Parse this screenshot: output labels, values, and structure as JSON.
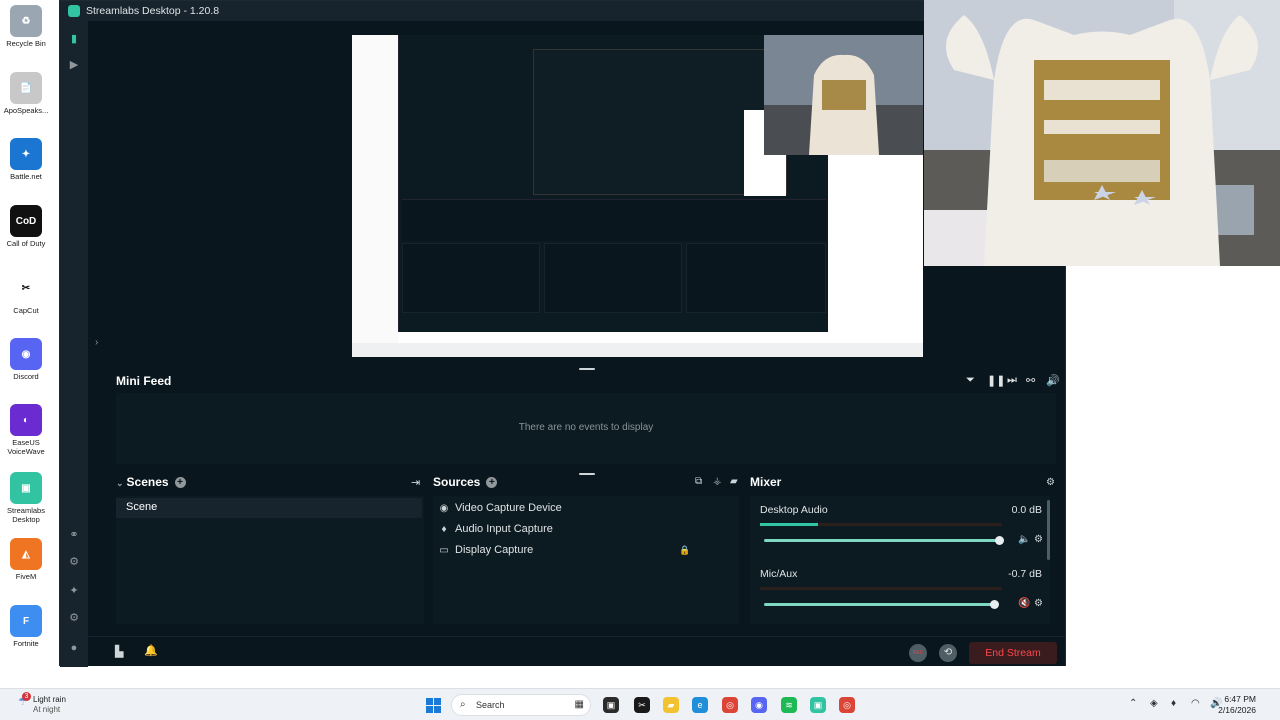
{
  "desktop": {
    "icons": [
      {
        "label": "Recycle Bin",
        "symbol": "♻",
        "color": "#9aa6b2"
      },
      {
        "label": "ApoSpeaks...",
        "symbol": "📄",
        "color": "#c8c8c8"
      },
      {
        "label": "Battle.net",
        "symbol": "✦",
        "color": "#1b76d2"
      },
      {
        "label": "Call of Duty",
        "symbol": "CoD",
        "color": "#111111"
      },
      {
        "label": "CapCut",
        "symbol": "✂",
        "color": "#ffffff"
      },
      {
        "label": "Discord",
        "symbol": "◉",
        "color": "#5865f2"
      },
      {
        "label": "EaseUS VoiceWave",
        "symbol": "◐",
        "color": "#6a2bd1"
      },
      {
        "label": "Streamlabs Desktop",
        "symbol": "▣",
        "color": "#31c3a2"
      },
      {
        "label": "FiveM",
        "symbol": "◭",
        "color": "#f07522"
      },
      {
        "label": "Fortnite",
        "symbol": "F",
        "color": "#3d8ef0"
      }
    ]
  },
  "app": {
    "title": "Streamlabs Desktop - 1.20.8",
    "mini_feed": {
      "title": "Mini Feed",
      "empty_text": "There are no events to display"
    },
    "scenes": {
      "title": "Scenes",
      "items": [
        "Scene"
      ]
    },
    "sources": {
      "title": "Sources",
      "items": [
        {
          "label": "Video Capture Device",
          "icon": "webcam-icon"
        },
        {
          "label": "Audio Input Capture",
          "icon": "microphone-icon"
        },
        {
          "label": "Display Capture",
          "icon": "monitor-icon"
        }
      ]
    },
    "mixer": {
      "title": "Mixer",
      "channels": [
        {
          "name": "Desktop Audio",
          "db": "0.0 dB",
          "level": 0.24,
          "volume": 1.0,
          "muted": false
        },
        {
          "name": "Mic/Aux",
          "db": "-0.7 dB",
          "level": 0.0,
          "volume": 0.98,
          "muted": true
        }
      ]
    },
    "footer": {
      "rec_label": "REC",
      "end_stream_label": "End Stream"
    },
    "colors": {
      "accent": "#31c3a2",
      "end_stream": "#fb484e"
    }
  },
  "taskbar": {
    "weather": {
      "title": "Light rain",
      "sub": "At night",
      "badge": "3"
    },
    "search_placeholder": "Search",
    "clock": {
      "time": "6:47 PM",
      "date": "2/16/2026"
    }
  }
}
